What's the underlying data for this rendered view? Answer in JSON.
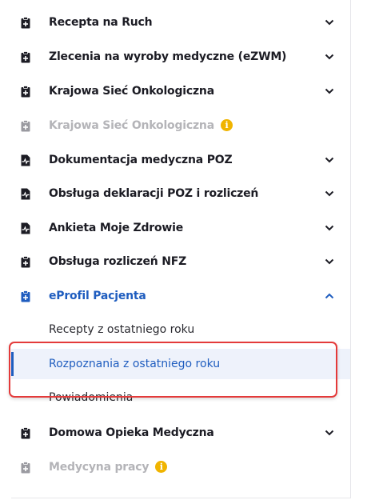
{
  "menu": {
    "items": [
      {
        "label": "Recepta na Ruch",
        "icon": "clipboard-icon",
        "expandable": true
      },
      {
        "label": "Zlecenia na wyroby medyczne (eZWM)",
        "icon": "clipboard-icon",
        "expandable": true
      },
      {
        "label": "Krajowa Sieć Onkologiczna",
        "icon": "clipboard-icon",
        "expandable": true
      },
      {
        "label": "Krajowa Sieć Onkologiczna",
        "icon": "clipboard-icon",
        "disabled": true,
        "info": "i"
      },
      {
        "label": "Dokumentacja medyczna POZ",
        "icon": "document-pulse-icon",
        "expandable": true
      },
      {
        "label": "Obsługa deklaracji POZ i rozliczeń",
        "icon": "document-pulse-icon",
        "expandable": true
      },
      {
        "label": "Ankieta Moje Zdrowie",
        "icon": "document-pulse-icon",
        "expandable": true
      },
      {
        "label": "Obsługa rozliczeń NFZ",
        "icon": "clipboard-icon",
        "expandable": true
      },
      {
        "label": "eProfil Pacjenta",
        "icon": "clipboard-icon",
        "expanded": true
      },
      {
        "label": "Domowa Opieka Medyczna",
        "icon": "clipboard-icon",
        "expandable": true
      },
      {
        "label": "Medycyna pracy",
        "icon": "clipboard-icon",
        "disabled": true,
        "info": "i"
      }
    ],
    "eprofil_subitems": [
      {
        "label": "Recepty z ostatniego roku"
      },
      {
        "label": "Rozpoznania z ostatniego roku",
        "selected": true
      },
      {
        "label": "Powiadomienia"
      }
    ]
  },
  "colors": {
    "accent": "#1f5dbf",
    "text": "#1c1c24",
    "disabled": "#b4b4b8",
    "info_badge": "#f0b400",
    "highlight_border": "#e43a3a",
    "selected_bg": "#eef2fb"
  }
}
